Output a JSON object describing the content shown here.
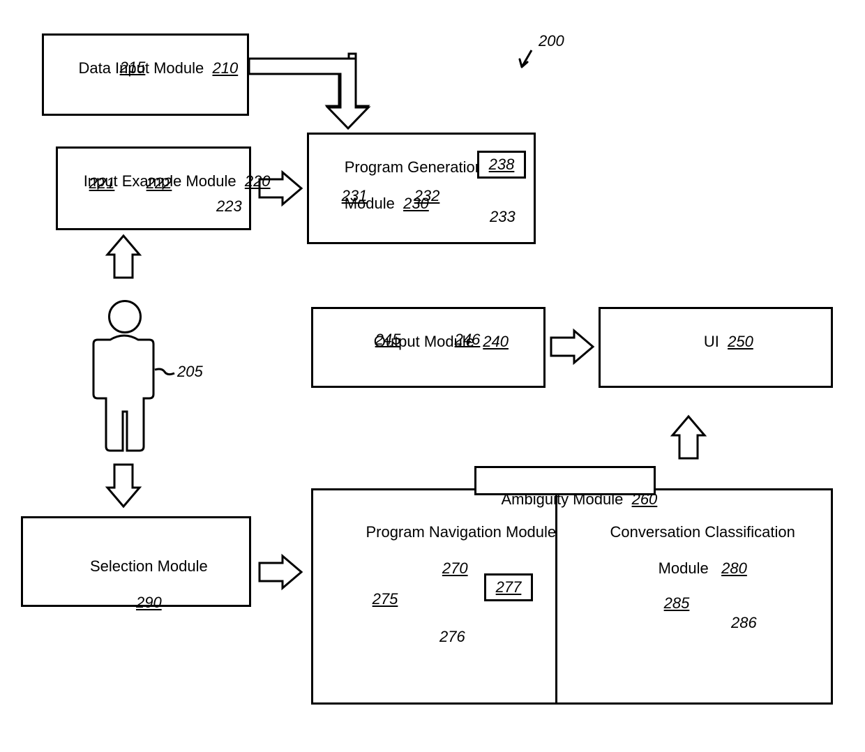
{
  "figure_ref": "200",
  "user_ref": "205",
  "modules": {
    "data_input": {
      "label": "Data Input Module",
      "ref": "210",
      "subs": {
        "a": "215"
      }
    },
    "input_ex": {
      "label": "Input Example Module",
      "ref": "220",
      "subs": {
        "a": "221",
        "b": "222"
      },
      "ell": "223"
    },
    "prog_gen": {
      "label": "Program Generation\nModule",
      "ref": "230",
      "subs": {
        "a": "231",
        "b": "232",
        "c": "238"
      },
      "ell": "233"
    },
    "output": {
      "label": "Output Module",
      "ref": "240",
      "subs": {
        "a": "245",
        "b": "246"
      }
    },
    "ui": {
      "label": "UI",
      "ref": "250"
    },
    "ambiguity": {
      "label": "Ambiguity Module",
      "ref": "260"
    },
    "prog_nav": {
      "label": "Program Navigation Module",
      "ref": "270",
      "subs": {
        "scroll": "275",
        "brace": "276",
        "b": "277"
      }
    },
    "conv_class": {
      "label": "Conversation Classification\nModule",
      "ref": "280",
      "subs": {
        "a": "285"
      },
      "ell": "286"
    },
    "selection": {
      "label": "Selection Module",
      "ref": "290"
    }
  }
}
